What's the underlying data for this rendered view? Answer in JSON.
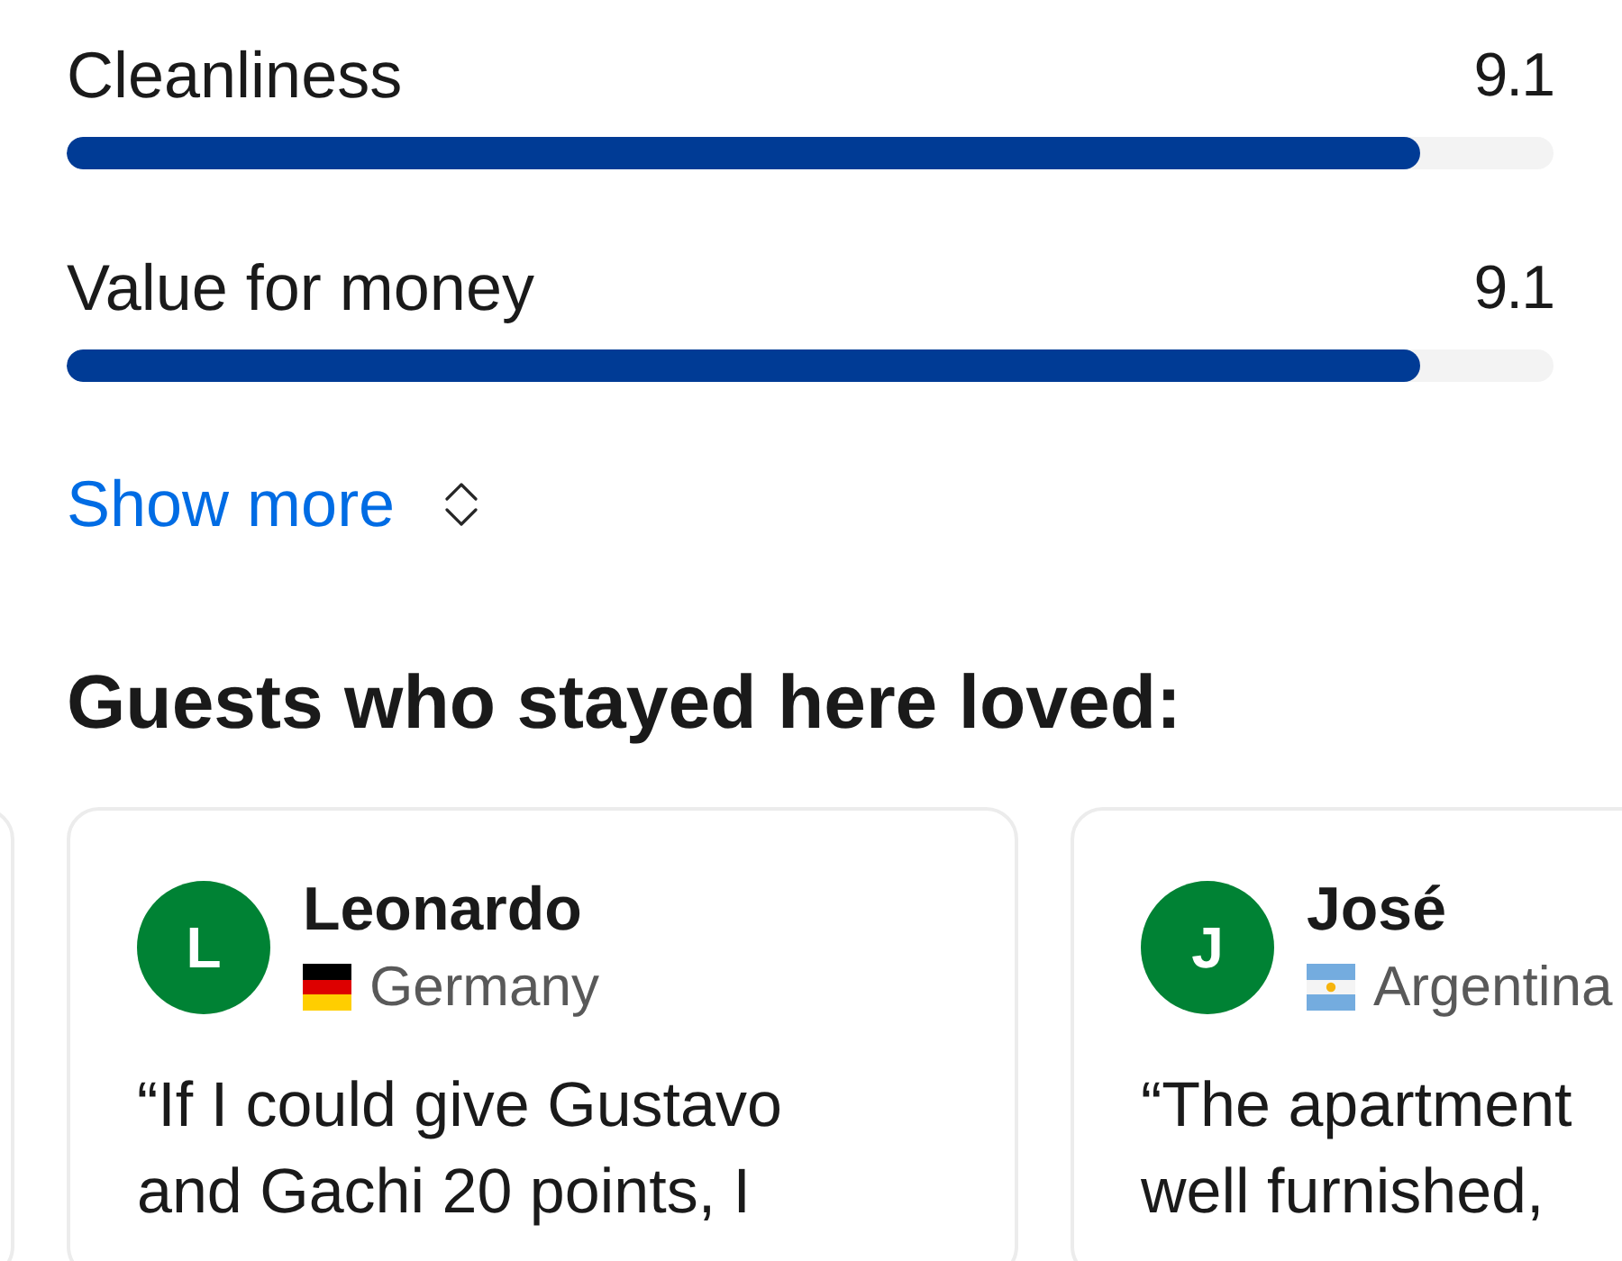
{
  "rating_bars": [
    {
      "label": "Cleanliness",
      "score": "9.1",
      "level": 0.91
    },
    {
      "label": "Value for money",
      "score": "9.1",
      "level": 0.91
    }
  ],
  "show_more": {
    "label": "Show more"
  },
  "loved_section": {
    "title": "Guests who stayed here loved:"
  },
  "reviews": [
    {
      "kind": "edge"
    },
    {
      "kind": "review",
      "initial": "L",
      "name": "Leonardo",
      "flag": {
        "kind": "germany"
      },
      "country": "Germany",
      "quote": "“If I could give Gustavo\nand Gachi 20 points, I"
    },
    {
      "kind": "review",
      "initial": "J",
      "name": "José",
      "flag": {
        "kind": "argentina"
      },
      "country": "Argentina",
      "quote": "“The apartment\nwell furnished,"
    }
  ]
}
